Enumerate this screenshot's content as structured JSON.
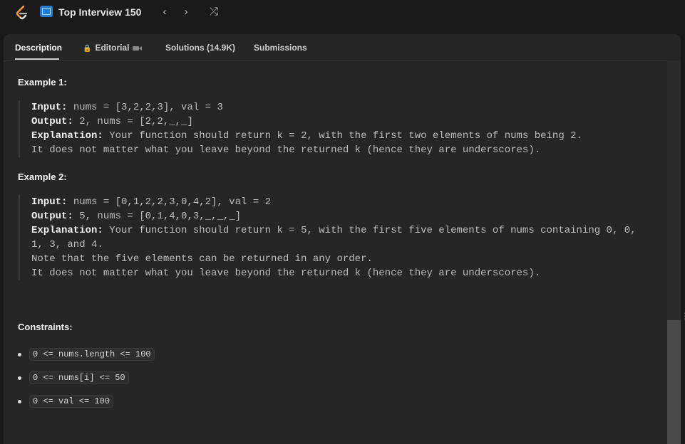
{
  "topbar": {
    "list_title": "Top Interview 150",
    "prev_icon": "‹",
    "next_icon": "›",
    "shuffle_icon": "⤮"
  },
  "tabs": {
    "description": "Description",
    "editorial": "Editorial",
    "solutions": "Solutions (14.9K)",
    "submissions": "Submissions",
    "lock_icon": "🔒"
  },
  "examples": [
    {
      "title": "Example 1:",
      "input_label": "Input:",
      "input_value": " nums = [3,2,2,3], val = 3",
      "output_label": "Output:",
      "output_value": " 2, nums = [2,2,_,_]",
      "explanation_label": "Explanation:",
      "explanation_value": " Your function should return k = 2, with the first two elements of nums being 2.",
      "extra": "It does not matter what you leave beyond the returned k (hence they are underscores)."
    },
    {
      "title": "Example 2:",
      "input_label": "Input:",
      "input_value": " nums = [0,1,2,2,3,0,4,2], val = 2",
      "output_label": "Output:",
      "output_value": " 5, nums = [0,1,4,0,3,_,_,_]",
      "explanation_label": "Explanation:",
      "explanation_value": " Your function should return k = 5, with the first five elements of nums containing 0, 0,\n1, 3, and 4.",
      "extra": "Note that the five elements can be returned in any order.\nIt does not matter what you leave beyond the returned k (hence they are underscores)."
    }
  ],
  "constraints": {
    "title": "Constraints:",
    "items": [
      "0 <= nums.length <= 100",
      "0 <= nums[i] <= 50",
      "0 <= val <= 100"
    ]
  },
  "colors": {
    "accent_orange": "#ffa116",
    "list_blue": "#1f7bd6"
  }
}
